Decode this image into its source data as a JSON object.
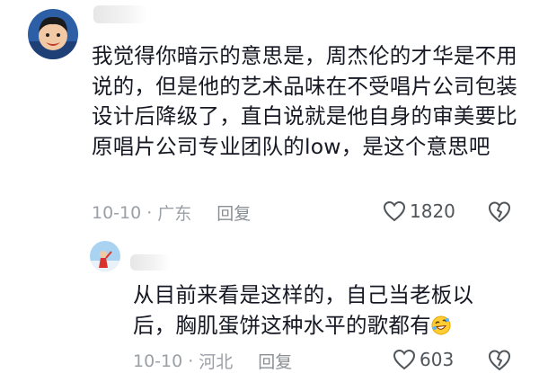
{
  "comments": [
    {
      "text": "我觉得你暗示的意思是，周杰伦的才华是不用说的，但是他的艺术品味在不受唱片公司包装设计后降级了，直白说就是他自身的审美要比原唱片公司专业团队的low，是这个意思吧",
      "date": "10-10",
      "location": "广东",
      "reply_label": "回复",
      "likes": "1820"
    },
    {
      "text": "从目前来看是这样的，自己当老板以后，胸肌蛋饼这种水平的歌都有",
      "emoji": "rolling-laughing-emoji",
      "date": "10-10",
      "location": "河北",
      "reply_label": "回复",
      "likes": "603"
    }
  ],
  "separator": "·",
  "colors": {
    "text": "#161823",
    "meta": "#9aa0a6"
  }
}
